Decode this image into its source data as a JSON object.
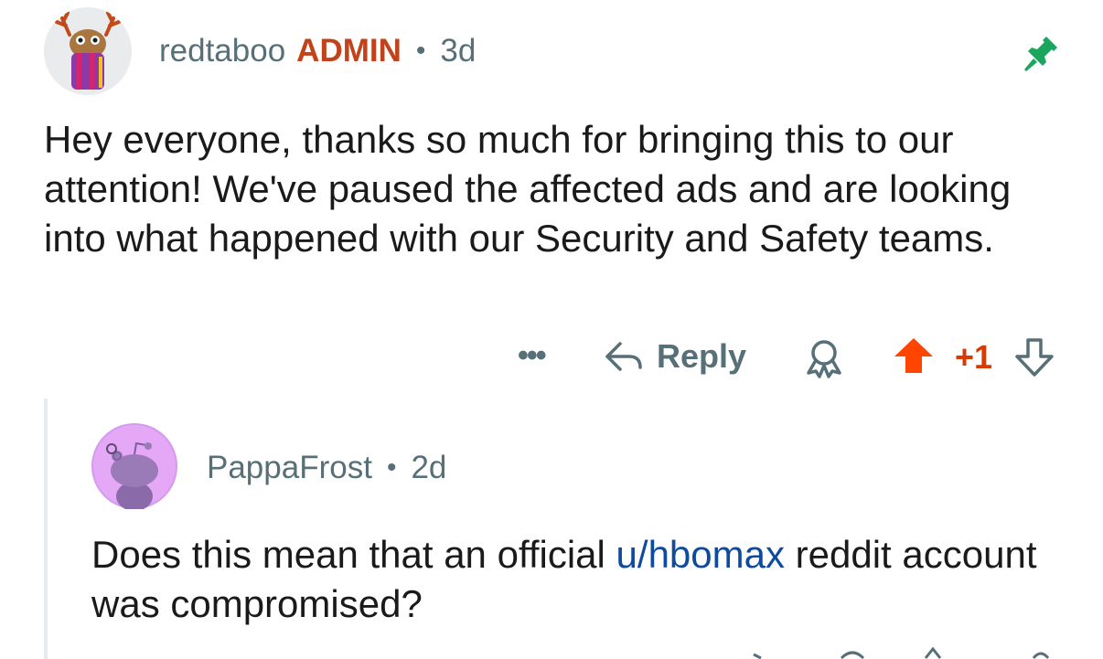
{
  "comment": {
    "username": "redtaboo",
    "role_badge": "ADMIN",
    "separator": "•",
    "age": "3d",
    "body": "Hey everyone, thanks so much for bringing this to our attention! We've paused the affected ads and are looking into what happened with our Security and Safety teams.",
    "actions": {
      "more_label": "•••",
      "reply_label": "Reply",
      "score": "+1"
    },
    "colors": {
      "admin": "#c24219",
      "pin": "#1aa65e",
      "upvote": "#ff4500",
      "score": "#d93a00",
      "meta": "#576f76"
    }
  },
  "reply": {
    "username": "PappaFrost",
    "separator": "•",
    "age": "2d",
    "body_before_link": "Does this mean that an official ",
    "link_text": "u/hbomax",
    "body_after_link": " reddit account was compromised?",
    "colors": {
      "link": "#0e4a9e",
      "avatar_bg": "#e4a8f7"
    }
  },
  "icons": {
    "pin": "pin-icon",
    "reply": "reply-arrow-icon",
    "award": "award-icon",
    "upvote": "upvote-arrow-icon",
    "downvote": "downvote-arrow-icon"
  }
}
